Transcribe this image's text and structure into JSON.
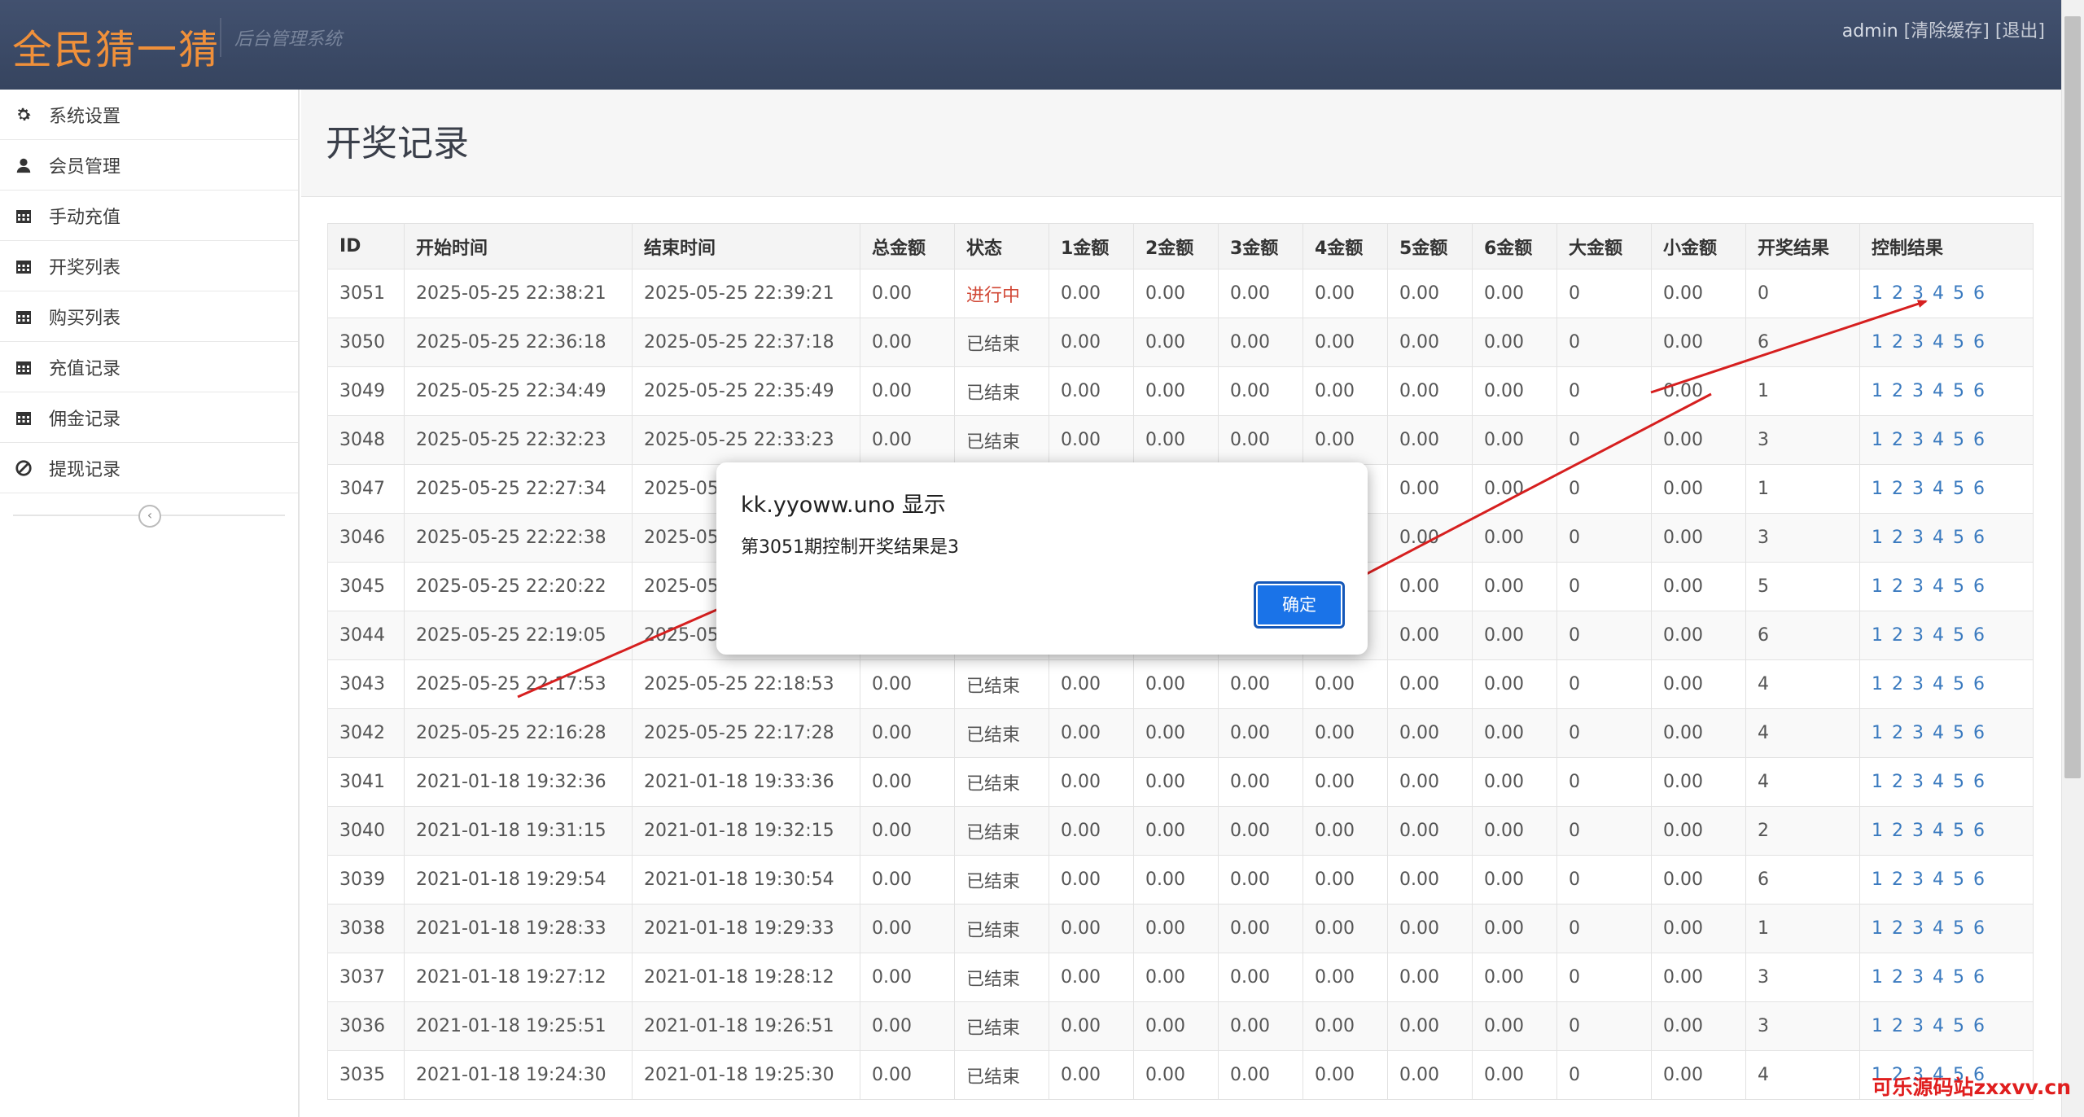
{
  "header": {
    "brand": "全民猜一猜",
    "subtitle": "后台管理系统",
    "user": "admin",
    "clear_cache": "[清除缓存]",
    "logout": "[退出]"
  },
  "sidebar": {
    "items": [
      {
        "label": "系统设置",
        "icon": "gear-icon"
      },
      {
        "label": "会员管理",
        "icon": "user-icon"
      },
      {
        "label": "手动充值",
        "icon": "calendar-icon"
      },
      {
        "label": "开奖列表",
        "icon": "calendar-icon"
      },
      {
        "label": "购买列表",
        "icon": "calendar-icon"
      },
      {
        "label": "充值记录",
        "icon": "calendar-icon"
      },
      {
        "label": "佣金记录",
        "icon": "calendar-icon"
      },
      {
        "label": "提现记录",
        "icon": "ban-icon"
      }
    ],
    "collapse_icon": "chevron-left-icon"
  },
  "page": {
    "title": "开奖记录"
  },
  "table": {
    "headers": [
      "ID",
      "开始时间",
      "结束时间",
      "总金额",
      "状态",
      "1金额",
      "2金额",
      "3金额",
      "4金额",
      "5金额",
      "6金额",
      "大金额",
      "小金额",
      "开奖结果",
      "控制结果"
    ],
    "control_links": [
      "1",
      "2",
      "3",
      "4",
      "5",
      "6"
    ],
    "rows": [
      [
        "3051",
        "2025-05-25 22:38:21",
        "2025-05-25 22:39:21",
        "0.00",
        "进行中",
        "0.00",
        "0.00",
        "0.00",
        "0.00",
        "0.00",
        "0.00",
        "0",
        "0.00",
        "0"
      ],
      [
        "3050",
        "2025-05-25 22:36:18",
        "2025-05-25 22:37:18",
        "0.00",
        "已结束",
        "0.00",
        "0.00",
        "0.00",
        "0.00",
        "0.00",
        "0.00",
        "0",
        "0.00",
        "6"
      ],
      [
        "3049",
        "2025-05-25 22:34:49",
        "2025-05-25 22:35:49",
        "0.00",
        "已结束",
        "0.00",
        "0.00",
        "0.00",
        "0.00",
        "0.00",
        "0.00",
        "0",
        "0.00",
        "1"
      ],
      [
        "3048",
        "2025-05-25 22:32:23",
        "2025-05-25 22:33:23",
        "0.00",
        "已结束",
        "0.00",
        "0.00",
        "0.00",
        "0.00",
        "0.00",
        "0.00",
        "0",
        "0.00",
        "3"
      ],
      [
        "3047",
        "2025-05-25 22:27:34",
        "2025-05-",
        "",
        "",
        "",
        "",
        "",
        "",
        "0.00",
        "0.00",
        "0",
        "0.00",
        "1"
      ],
      [
        "3046",
        "2025-05-25 22:22:38",
        "2025-05-",
        "",
        "",
        "",
        "",
        "",
        "",
        "0.00",
        "0.00",
        "0",
        "0.00",
        "3"
      ],
      [
        "3045",
        "2025-05-25 22:20:22",
        "2025-05-",
        "",
        "",
        "",
        "",
        "",
        "",
        "0.00",
        "0.00",
        "0",
        "0.00",
        "5"
      ],
      [
        "3044",
        "2025-05-25 22:19:05",
        "2025-05-",
        "",
        "",
        "",
        "",
        "",
        "",
        "0.00",
        "0.00",
        "0",
        "0.00",
        "6"
      ],
      [
        "3043",
        "2025-05-25 22:17:53",
        "2025-05-25 22:18:53",
        "0.00",
        "已结束",
        "0.00",
        "0.00",
        "0.00",
        "0.00",
        "0.00",
        "0.00",
        "0",
        "0.00",
        "4"
      ],
      [
        "3042",
        "2025-05-25 22:16:28",
        "2025-05-25 22:17:28",
        "0.00",
        "已结束",
        "0.00",
        "0.00",
        "0.00",
        "0.00",
        "0.00",
        "0.00",
        "0",
        "0.00",
        "4"
      ],
      [
        "3041",
        "2021-01-18 19:32:36",
        "2021-01-18 19:33:36",
        "0.00",
        "已结束",
        "0.00",
        "0.00",
        "0.00",
        "0.00",
        "0.00",
        "0.00",
        "0",
        "0.00",
        "4"
      ],
      [
        "3040",
        "2021-01-18 19:31:15",
        "2021-01-18 19:32:15",
        "0.00",
        "已结束",
        "0.00",
        "0.00",
        "0.00",
        "0.00",
        "0.00",
        "0.00",
        "0",
        "0.00",
        "2"
      ],
      [
        "3039",
        "2021-01-18 19:29:54",
        "2021-01-18 19:30:54",
        "0.00",
        "已结束",
        "0.00",
        "0.00",
        "0.00",
        "0.00",
        "0.00",
        "0.00",
        "0",
        "0.00",
        "6"
      ],
      [
        "3038",
        "2021-01-18 19:28:33",
        "2021-01-18 19:29:33",
        "0.00",
        "已结束",
        "0.00",
        "0.00",
        "0.00",
        "0.00",
        "0.00",
        "0.00",
        "0",
        "0.00",
        "1"
      ],
      [
        "3037",
        "2021-01-18 19:27:12",
        "2021-01-18 19:28:12",
        "0.00",
        "已结束",
        "0.00",
        "0.00",
        "0.00",
        "0.00",
        "0.00",
        "0.00",
        "0",
        "0.00",
        "3"
      ],
      [
        "3036",
        "2021-01-18 19:25:51",
        "2021-01-18 19:26:51",
        "0.00",
        "已结束",
        "0.00",
        "0.00",
        "0.00",
        "0.00",
        "0.00",
        "0.00",
        "0",
        "0.00",
        "3"
      ],
      [
        "3035",
        "2021-01-18 19:24:30",
        "2021-01-18 19:25:30",
        "0.00",
        "已结束",
        "0.00",
        "0.00",
        "0.00",
        "0.00",
        "0.00",
        "0.00",
        "0",
        "0.00",
        "4"
      ]
    ]
  },
  "dialog": {
    "title": "kk.yyoww.uno 显示",
    "message": "第3051期控制开奖结果是3",
    "ok_label": "确定"
  },
  "watermark": "可乐源码站zxxvv.cn",
  "colors": {
    "header_bg": "#3b4a69",
    "brand": "#f0903a",
    "running_status": "#d14836",
    "link": "#3a7abf",
    "dialog_button": "#1a73e8",
    "annotation_arrow": "#d61f1f"
  }
}
